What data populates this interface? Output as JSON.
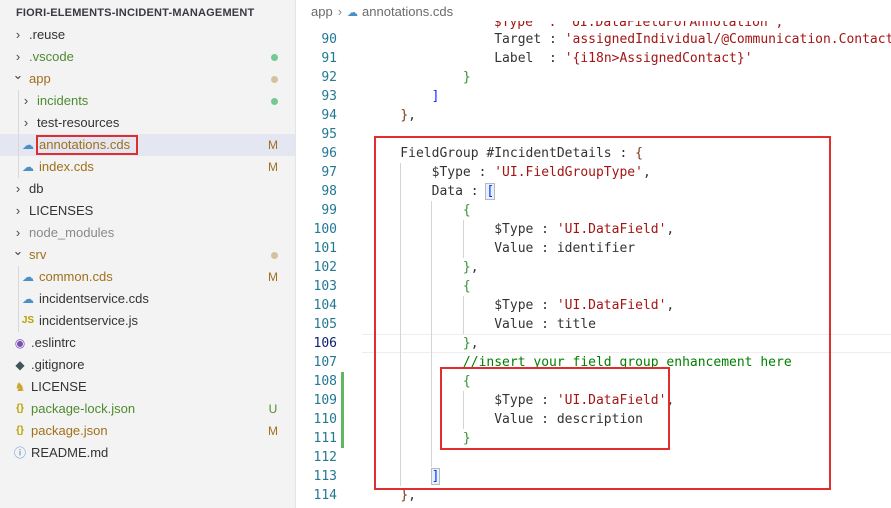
{
  "explorer": {
    "title": "FIORI-ELEMENTS-INCIDENT-MANAGEMENT",
    "items": [
      {
        "label": ".reuse",
        "depth": 0,
        "kind": "folder",
        "open": false,
        "status": "",
        "color": "#333333"
      },
      {
        "label": ".vscode",
        "depth": 0,
        "kind": "folder",
        "open": false,
        "status": "dot",
        "color": "#4e8b2f",
        "dot_color": "#73c991"
      },
      {
        "label": "app",
        "depth": 0,
        "kind": "folder",
        "open": true,
        "status": "dot",
        "color": "#a0701b",
        "dot_color": "#d6c29a"
      },
      {
        "label": "incidents",
        "depth": 1,
        "kind": "folder",
        "open": false,
        "status": "dot",
        "color": "#4e8b2f",
        "dot_color": "#73c991"
      },
      {
        "label": "test-resources",
        "depth": 1,
        "kind": "folder",
        "open": false,
        "status": "",
        "color": "#333333"
      },
      {
        "label": "annotations.cds",
        "depth": 1,
        "kind": "cds",
        "open": false,
        "status": "M",
        "color": "#a0701b",
        "selected": true,
        "highlight": true
      },
      {
        "label": "index.cds",
        "depth": 1,
        "kind": "cds",
        "open": false,
        "status": "M",
        "color": "#a0701b"
      },
      {
        "label": "db",
        "depth": 0,
        "kind": "folder",
        "open": false,
        "status": "",
        "color": "#333333"
      },
      {
        "label": "LICENSES",
        "depth": 0,
        "kind": "folder",
        "open": false,
        "status": "",
        "color": "#333333"
      },
      {
        "label": "node_modules",
        "depth": 0,
        "kind": "folder",
        "open": false,
        "status": "",
        "color": "#8a8a8a"
      },
      {
        "label": "srv",
        "depth": 0,
        "kind": "folder",
        "open": true,
        "status": "dot",
        "color": "#a0701b",
        "dot_color": "#d6c29a"
      },
      {
        "label": "common.cds",
        "depth": 1,
        "kind": "cds",
        "open": false,
        "status": "M",
        "color": "#a0701b"
      },
      {
        "label": "incidentservice.cds",
        "depth": 1,
        "kind": "cds",
        "open": false,
        "status": "",
        "color": "#333333"
      },
      {
        "label": "incidentservice.js",
        "depth": 1,
        "kind": "js",
        "open": false,
        "status": "",
        "color": "#333333"
      },
      {
        "label": ".eslintrc",
        "depth": 0,
        "kind": "eslint",
        "open": false,
        "status": "",
        "color": "#333333"
      },
      {
        "label": ".gitignore",
        "depth": 0,
        "kind": "git",
        "open": false,
        "status": "",
        "color": "#333333"
      },
      {
        "label": "LICENSE",
        "depth": 0,
        "kind": "license",
        "open": false,
        "status": "",
        "color": "#333333"
      },
      {
        "label": "package-lock.json",
        "depth": 0,
        "kind": "json",
        "open": false,
        "status": "U",
        "color": "#4e8b2f"
      },
      {
        "label": "package.json",
        "depth": 0,
        "kind": "json",
        "open": false,
        "status": "M",
        "color": "#a0701b"
      },
      {
        "label": "README.md",
        "depth": 0,
        "kind": "info",
        "open": false,
        "status": "",
        "color": "#333333"
      }
    ]
  },
  "breadcrumb": {
    "folder": "app",
    "file": "annotations.cds"
  },
  "editor": {
    "lines": [
      {
        "n": "90",
        "segs": [
          [
            "k",
            "                "
          ],
          [
            "k",
            "Target : "
          ],
          [
            "s",
            "'assignedIndividual/@Communication.Contact'"
          ],
          [
            "k",
            ","
          ]
        ]
      },
      {
        "n": "91",
        "segs": [
          [
            "k",
            "                "
          ],
          [
            "k",
            "Label  : "
          ],
          [
            "s",
            "'{i18n>AssignedContact}'"
          ]
        ]
      },
      {
        "n": "92",
        "segs": [
          [
            "k",
            "            "
          ],
          [
            "b2",
            "}"
          ]
        ]
      },
      {
        "n": "93",
        "segs": [
          [
            "k",
            "        "
          ],
          [
            "b1",
            "]"
          ]
        ]
      },
      {
        "n": "94",
        "segs": [
          [
            "k",
            "    "
          ],
          [
            "b3",
            "}"
          ],
          [
            "k",
            ","
          ]
        ]
      },
      {
        "n": "95",
        "segs": []
      },
      {
        "n": "96",
        "segs": [
          [
            "k",
            "    FieldGroup #IncidentDetails : "
          ],
          [
            "b3",
            "{"
          ]
        ]
      },
      {
        "n": "97",
        "segs": [
          [
            "k",
            "        $Type : "
          ],
          [
            "s",
            "'UI.FieldGroupType'"
          ],
          [
            "k",
            ","
          ]
        ]
      },
      {
        "n": "98",
        "segs": [
          [
            "k",
            "        Data : "
          ],
          [
            "b1box",
            "["
          ]
        ]
      },
      {
        "n": "99",
        "segs": [
          [
            "k",
            "            "
          ],
          [
            "b2",
            "{"
          ]
        ]
      },
      {
        "n": "100",
        "segs": [
          [
            "k",
            "                $Type : "
          ],
          [
            "s",
            "'UI.DataField'"
          ],
          [
            "k",
            ","
          ]
        ]
      },
      {
        "n": "101",
        "segs": [
          [
            "k",
            "                Value : identifier"
          ]
        ]
      },
      {
        "n": "102",
        "segs": [
          [
            "k",
            "            "
          ],
          [
            "b2",
            "}"
          ],
          [
            "k",
            ","
          ]
        ]
      },
      {
        "n": "103",
        "segs": [
          [
            "k",
            "            "
          ],
          [
            "b2",
            "{"
          ]
        ]
      },
      {
        "n": "104",
        "segs": [
          [
            "k",
            "                $Type : "
          ],
          [
            "s",
            "'UI.DataField'"
          ],
          [
            "k",
            ","
          ]
        ]
      },
      {
        "n": "105",
        "segs": [
          [
            "k",
            "                Value : title"
          ]
        ]
      },
      {
        "n": "106",
        "segs": [
          [
            "k",
            "            "
          ],
          [
            "b2",
            "}"
          ],
          [
            "k",
            ","
          ]
        ]
      },
      {
        "n": "107",
        "segs": [
          [
            "k",
            "            "
          ],
          [
            "c",
            "//insert your field group enhancement here"
          ]
        ]
      },
      {
        "n": "108",
        "segs": [
          [
            "k",
            "            "
          ],
          [
            "b2",
            "{"
          ]
        ]
      },
      {
        "n": "109",
        "segs": [
          [
            "k",
            "                $Type : "
          ],
          [
            "s",
            "'UI.DataField'"
          ],
          [
            "k",
            ","
          ]
        ]
      },
      {
        "n": "110",
        "segs": [
          [
            "k",
            "                Value : description"
          ]
        ]
      },
      {
        "n": "111",
        "segs": [
          [
            "k",
            "            "
          ],
          [
            "b2",
            "}"
          ]
        ]
      },
      {
        "n": "112",
        "segs": []
      },
      {
        "n": "113",
        "segs": [
          [
            "k",
            "        "
          ],
          [
            "b1box",
            "]"
          ]
        ]
      },
      {
        "n": "114",
        "segs": [
          [
            "k",
            "    "
          ],
          [
            "b3",
            "}"
          ],
          [
            "k",
            ","
          ]
        ]
      }
    ],
    "cropped_top_text": "$Type  : 'UI.DataFieldForAnnotation',",
    "current_line": "106",
    "modified_lines": [
      "108",
      "109",
      "110",
      "111"
    ]
  },
  "colors": {
    "highlight_red": "#e02d2d",
    "line_number": "#237893",
    "string": "#a31515",
    "comment": "#008000",
    "git_modified": "#a0701b",
    "git_untracked": "#4e8b2f"
  }
}
